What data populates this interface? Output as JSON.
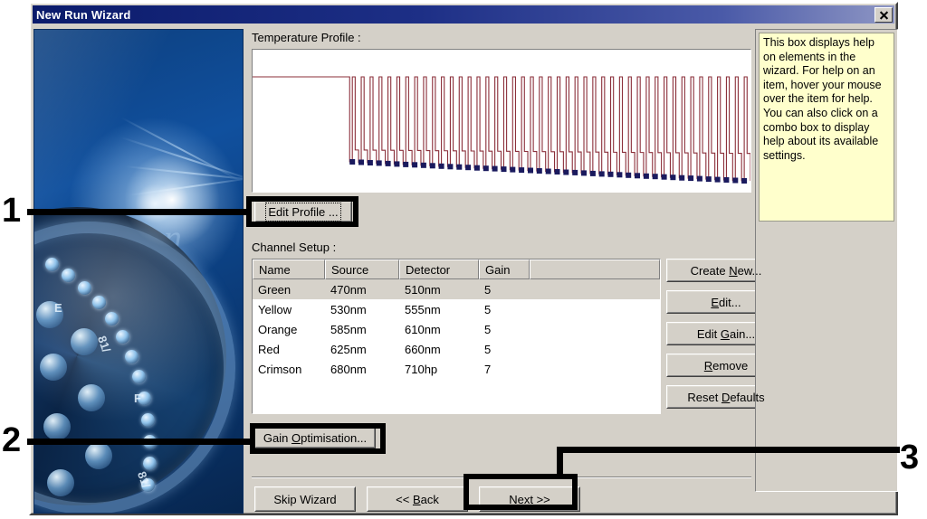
{
  "window": {
    "title": "New Run Wizard",
    "close_icon": "close-icon"
  },
  "sections": {
    "temperature_profile_label": "Temperature Profile :",
    "channel_setup_label": "Channel Setup :"
  },
  "buttons": {
    "edit_profile": "Edit Profile ...",
    "gain_optimisation": "Gain Optimisation...",
    "create_new": "Create New...",
    "edit": "Edit...",
    "edit_gain": "Edit Gain...",
    "remove": "Remove",
    "reset_defaults": "Reset Defaults",
    "skip_wizard": "Skip Wizard",
    "back": "<< Back",
    "next": "Next >>"
  },
  "channel_table": {
    "columns": [
      "Name",
      "Source",
      "Detector",
      "Gain",
      ""
    ],
    "rows": [
      {
        "name": "Green",
        "source": "470nm",
        "detector": "510nm",
        "gain": "5",
        "selected": true
      },
      {
        "name": "Yellow",
        "source": "530nm",
        "detector": "555nm",
        "gain": "5",
        "selected": false
      },
      {
        "name": "Orange",
        "source": "585nm",
        "detector": "610nm",
        "gain": "5",
        "selected": false
      },
      {
        "name": "Red",
        "source": "625nm",
        "detector": "660nm",
        "gain": "5",
        "selected": false
      },
      {
        "name": "Crimson",
        "source": "680nm",
        "detector": "710hp",
        "gain": "7",
        "selected": false
      }
    ]
  },
  "help_panel": {
    "text": "This box displays help on elements in the wizard. For help on an item, hover your mouse over the item for help. You can also click on a combo box to display help about its available settings."
  },
  "annotations": [
    {
      "number": "1",
      "target": "edit-profile-button"
    },
    {
      "number": "2",
      "target": "gain-optimisation-button"
    },
    {
      "number": "3",
      "target": "next-button"
    }
  ],
  "colors": {
    "titlebar": "#0b1b6b",
    "dialog_face": "#d4d0c8",
    "help_background": "#ffffcc",
    "selection": "#d6d2ca",
    "profile_line": "#8b2f3a",
    "acquisition_marker": "#1a1a5e",
    "annotation": "#000000"
  },
  "chart_data": {
    "type": "line",
    "title": "Temperature Profile :",
    "xlabel": "",
    "ylabel": "",
    "grid": false,
    "legend": false,
    "hold_phase": {
      "level": 1.0,
      "length_fraction": 0.195
    },
    "cycle_count": 45,
    "cycle_high": 1.0,
    "cycle_low_start": 0.36,
    "cycle_low_end": 0.06,
    "acquisition_marker_count": 45,
    "description": "PCR thermal cycling profile: an initial high-temperature hold followed by 45 denature/anneal cycles; dark square markers denote fluorescence acquisition points at the low step of each cycle."
  }
}
